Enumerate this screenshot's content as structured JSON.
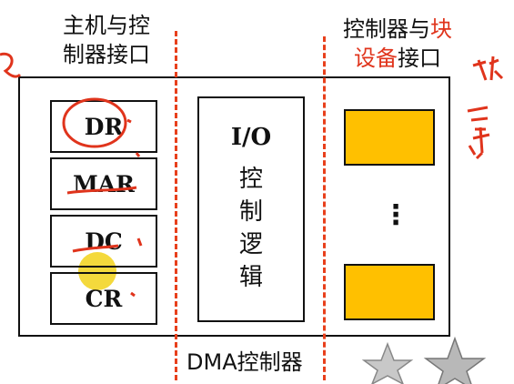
{
  "host_interface": {
    "line1": "主机与控",
    "line2": "制器接口"
  },
  "device_interface": {
    "line1_black": "控制器与",
    "line1_red": "块",
    "line2_red": "设备",
    "line2_black": "接口"
  },
  "registers": [
    {
      "label": "DR"
    },
    {
      "label": "MAR"
    },
    {
      "label": "DC"
    },
    {
      "label": "CR"
    }
  ],
  "io_logic": {
    "line1": "I/O",
    "chars": [
      "控",
      "制",
      "逻",
      "辑"
    ]
  },
  "device_blocks": {
    "ellipsis": "⋮"
  },
  "dma_label": "DMA控制器",
  "colors": {
    "dashed_lines": "#e8401c",
    "blocks": "#ffc000",
    "annotation_red": "#e0341c",
    "highlight": "#f2d21a"
  }
}
